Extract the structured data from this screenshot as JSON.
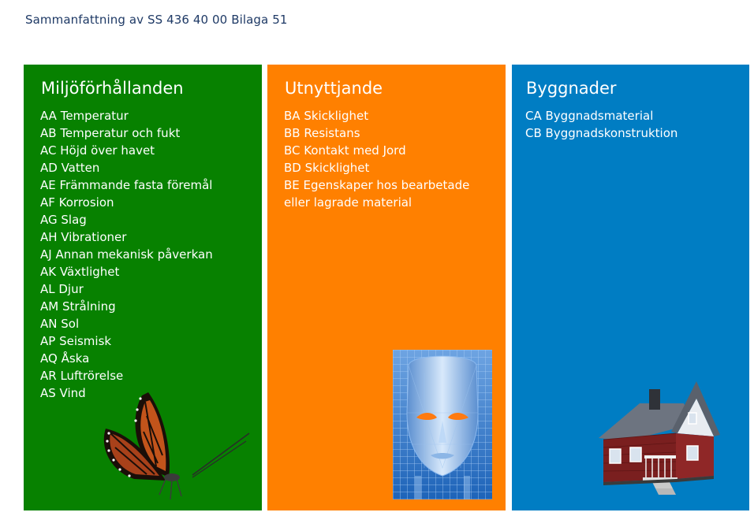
{
  "page_title": "Sammanfattning av SS 436 40 00 Bilaga 51",
  "panels": [
    {
      "heading": "Miljöförhållanden",
      "color": "#078100",
      "illustration": "butterfly",
      "items": [
        "AA Temperatur",
        "AB Temperatur och fukt",
        "AC Höjd över havet",
        "AD Vatten",
        "AE Främmande fasta föremål",
        "AF Korrosion",
        "AG Slag",
        "AH Vibrationer",
        "AJ Annan mekanisk påverkan",
        "AK Växtlighet",
        "AL Djur",
        "AM Strålning",
        "AN Sol",
        "AP Seismisk",
        "AQ Åska",
        "AR Luftrörelse",
        "AS Vind"
      ]
    },
    {
      "heading": "Utnyttjande",
      "color": "#ff8000",
      "illustration": "digital-face",
      "items": [
        "BA Skicklighet",
        "BB Resistans",
        "BC Kontakt med Jord",
        "BD Skicklighet",
        "BE Egenskaper hos bearbetade eller lagrade material"
      ]
    },
    {
      "heading": "Byggnader",
      "color": "#007dc3",
      "illustration": "house",
      "items": [
        "CA Byggnadsmaterial",
        "CB Byggnadskonstruktion"
      ]
    }
  ]
}
